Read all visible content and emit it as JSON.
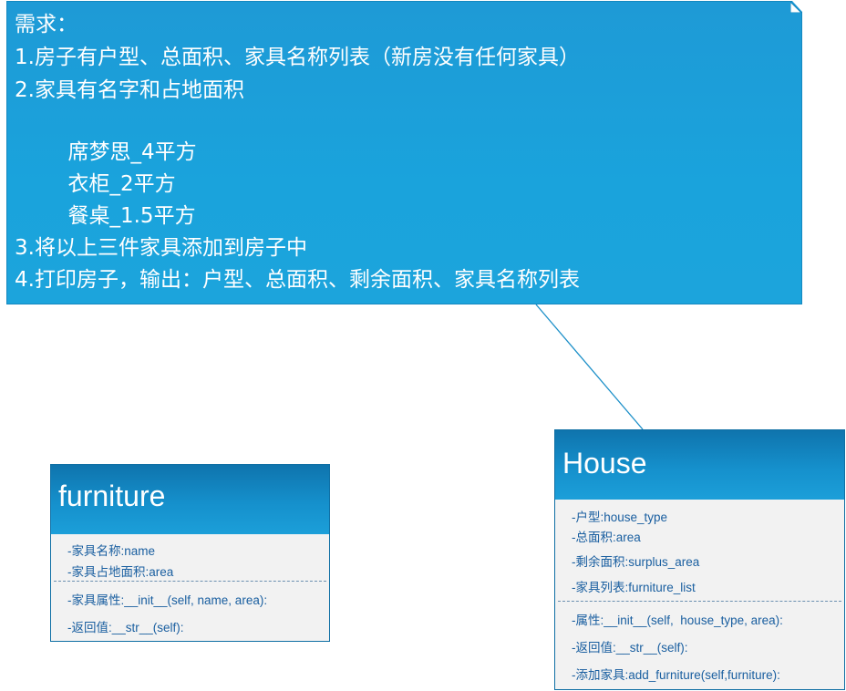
{
  "requirements_note": {
    "lines": [
      "需求：",
      "1.房子有户型、总面积、家具名称列表（新房没有任何家具）",
      "2.家具有名字和占地面积",
      "",
      "        席梦思_4平方",
      "        衣柜_2平方",
      "        餐桌_1.5平方",
      "3.将以上三件家具添加到房子中",
      "4.打印房子，输出：户型、总面积、剩余面积、家具名称列表"
    ]
  },
  "furniture_class": {
    "title": "furniture",
    "attributes": [
      "-家具名称:name",
      "-家具占地面积:area"
    ],
    "methods": [
      "-家具属性:__init__(self, name, area):",
      "-返回值:__str__(self):"
    ]
  },
  "house_class": {
    "title": "House",
    "attributes": [
      "-户型:house_type",
      "-总面积:area",
      "-剩余面积:surplus_area",
      "-家具列表:furniture_list"
    ],
    "methods": [
      "-属性:__init__(self,  house_type, area):",
      "-返回值:__str__(self):",
      "-添加家具:add_furniture(self,furniture):"
    ]
  },
  "colors": {
    "note_fill": "#1ca4dc",
    "class_header": "#1590cc",
    "class_body": "#f2f2f2",
    "member_text": "#1a5fa0"
  }
}
